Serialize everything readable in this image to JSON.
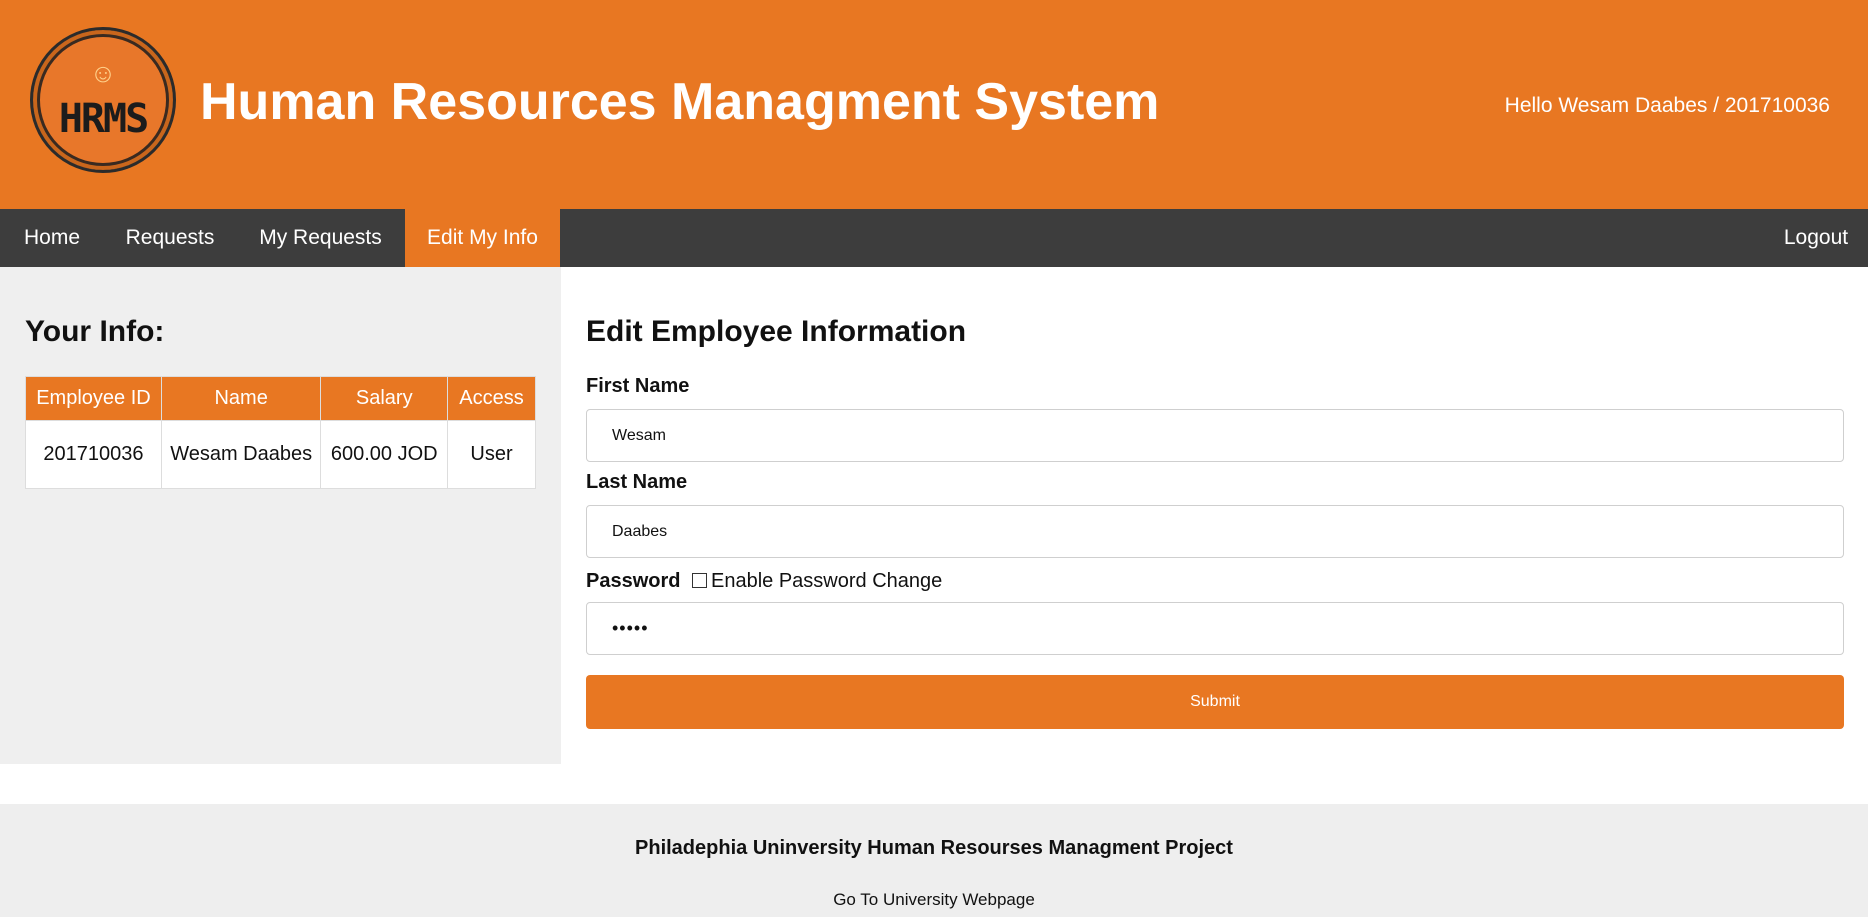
{
  "header": {
    "logo_text": "HRMS",
    "title": "Human Resources Managment System",
    "greeting": "Hello Wesam Daabes / 201710036"
  },
  "nav": {
    "home": "Home",
    "requests": "Requests",
    "my_requests": "My Requests",
    "edit_info": "Edit My Info",
    "logout": "Logout"
  },
  "sidebar": {
    "title": "Your Info:",
    "columns": [
      "Employee ID",
      "Name",
      "Salary",
      "Access"
    ],
    "row": {
      "employee_id": "201710036",
      "name": "Wesam Daabes",
      "salary": "600.00 JOD",
      "access": "User"
    }
  },
  "form": {
    "title": "Edit Employee Information",
    "first_name_label": "First Name",
    "first_name_value": "Wesam",
    "last_name_label": "Last Name",
    "last_name_value": "Daabes",
    "password_label": "Password",
    "enable_password_label": "Enable Password Change",
    "password_value": "•••••",
    "submit_label": "Submit"
  },
  "footer": {
    "title": "Philadephia Uninversity Human Resourses Managment Project",
    "link": "Go To University Webpage"
  },
  "colors": {
    "accent": "#e87722",
    "nav_bg": "#3d3d3d",
    "sidebar_bg": "#efefef"
  }
}
